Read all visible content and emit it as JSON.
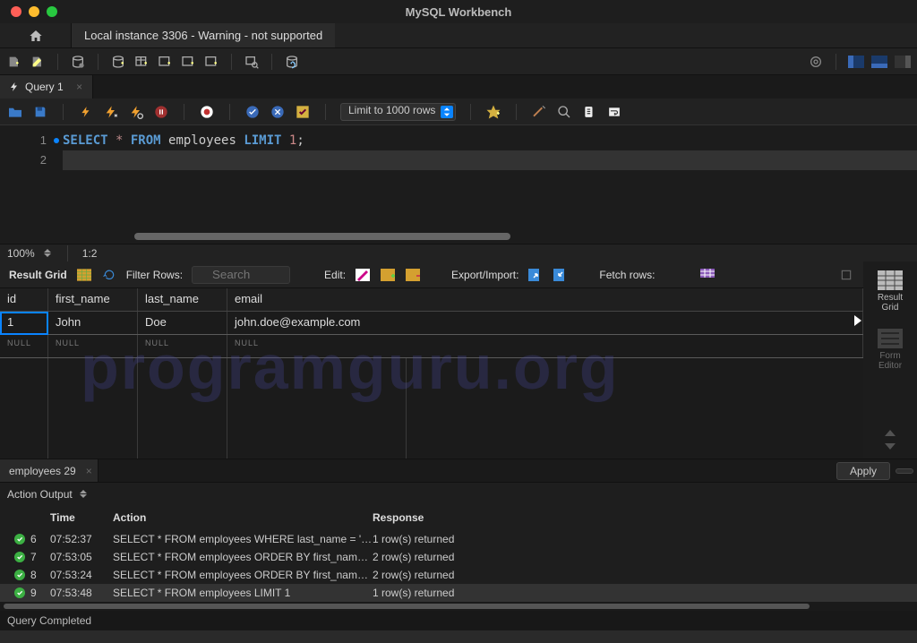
{
  "title": "MySQL Workbench",
  "connection_tab": "Local instance 3306 - Warning - not supported",
  "query_tab": "Query 1",
  "editor": {
    "line1_kw1": "SELECT",
    "line1_star": " * ",
    "line1_kw2": "FROM",
    "line1_ident": " employees ",
    "line1_kw3": "LIMIT",
    "line1_num": " 1",
    "line1_semi": ";",
    "ln1": "1",
    "ln2": "2"
  },
  "zoom": "100%",
  "cursorpos": "1:2",
  "limit_label": "Limit to 1000 rows",
  "result": {
    "header": "Result Grid",
    "filter_label": "Filter Rows:",
    "search_placeholder": "Search",
    "edit_label": "Edit:",
    "export_label": "Export/Import:",
    "fetch_label": "Fetch rows:",
    "cols": {
      "id": "id",
      "first_name": "first_name",
      "last_name": "last_name",
      "email": "email"
    },
    "row": {
      "id": "1",
      "first_name": "John",
      "last_name": "Doe",
      "email": "john.doe@example.com"
    },
    "null": "NULL"
  },
  "side": {
    "result_grid": "Result\nGrid",
    "form_editor": "Form\nEditor"
  },
  "grid_tab": "employees 29",
  "apply": "Apply",
  "output_header": "Action Output",
  "output_cols": {
    "time": "Time",
    "action": "Action",
    "response": "Response"
  },
  "output_rows": [
    {
      "idx": "6",
      "time": "07:52:37",
      "action": "SELECT * FROM employees WHERE last_name = 'Do…",
      "resp": "1 row(s) returned"
    },
    {
      "idx": "7",
      "time": "07:53:05",
      "action": "SELECT * FROM employees ORDER BY first_name A…",
      "resp": "2 row(s) returned"
    },
    {
      "idx": "8",
      "time": "07:53:24",
      "action": "SELECT * FROM employees ORDER BY first_name A…",
      "resp": "2 row(s) returned"
    },
    {
      "idx": "9",
      "time": "07:53:48",
      "action": "SELECT * FROM employees LIMIT 1",
      "resp": "1 row(s) returned"
    }
  ],
  "status": "Query Completed",
  "watermark": "programguru.org"
}
